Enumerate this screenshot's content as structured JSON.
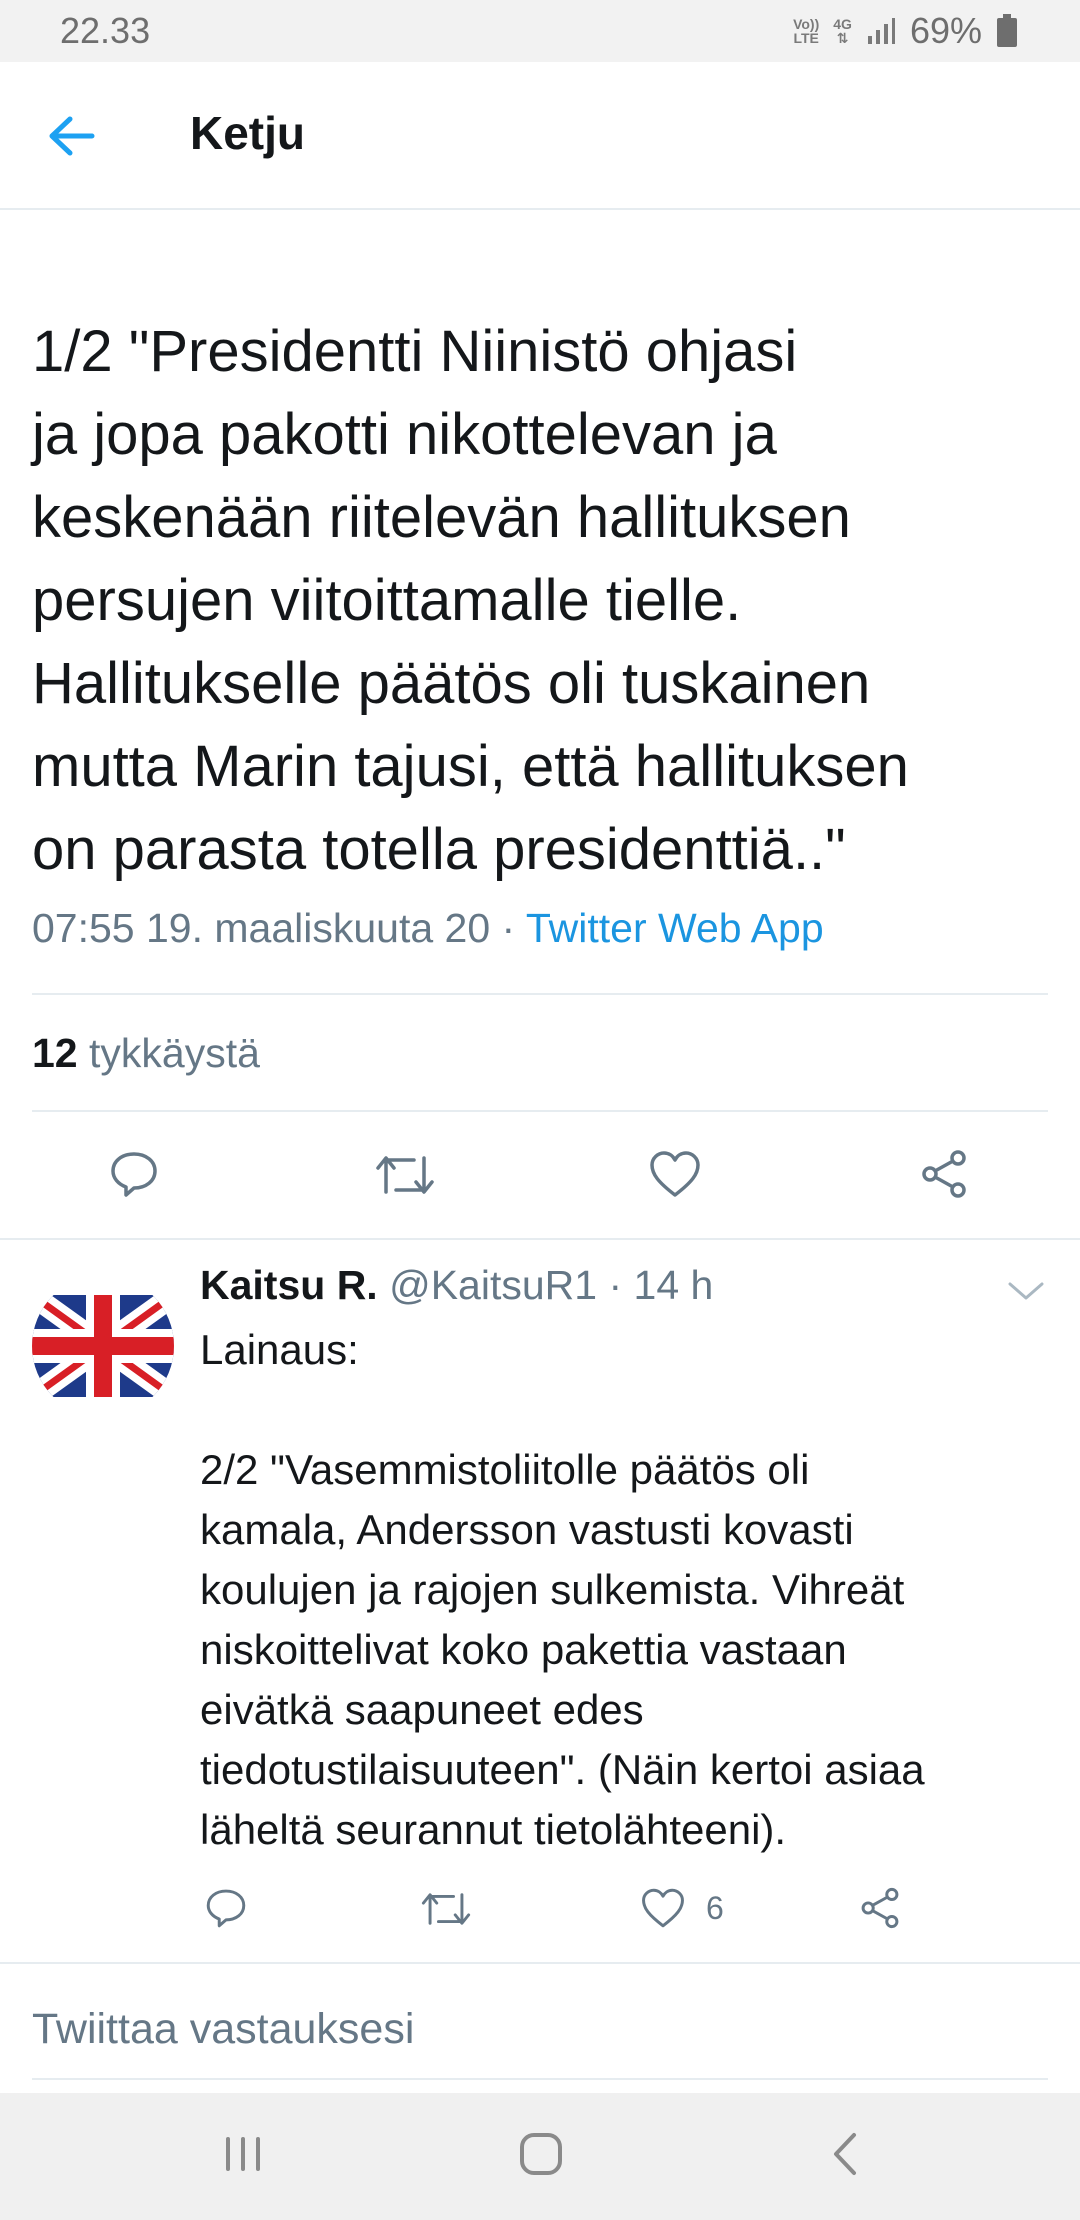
{
  "status_bar": {
    "time": "22.33",
    "volte_top": "Vo))",
    "volte_bottom": "LTE",
    "network": "4G",
    "battery": "69%"
  },
  "header": {
    "title": "Ketju",
    "back_icon": "arrow-left-icon"
  },
  "tweet": {
    "text": "1/2 \"Presidentti Niinistö ohjasi\nja jopa pakotti nikottelevan ja\nkeskenään riitelevän hallituksen\npersujen viitoittamalle tielle.\nHallitukselle päätös oli tuskainen\nmutta Marin tajusi, että hallituksen\non parasta totella presidenttiä..\"",
    "timestamp": "07:55 19. maaliskuuta 20",
    "separator": " · ",
    "source_app": "Twitter Web App",
    "likes_count": "12",
    "likes_label": " tykkäystä"
  },
  "reply": {
    "name": "Kaitsu R.",
    "handle": " @KaitsuR1",
    "time": " · 14 h",
    "text": "Lainaus:\n\n2/2 \"Vasemmistoliitolle päätös oli\nkamala, Andersson vastusti kovasti\nkoulujen ja rajojen sulkemista. Vihreät\nniskoittelivat koko pakettia vastaan\neivätkä saapuneet edes\ntiedotustilaisuuteen\". (Näin kertoi asiaa\nläheltä seurannut tietolähteeni).",
    "like_count": "6"
  },
  "compose": {
    "placeholder": "Twiittaa vastauksesi"
  },
  "colors": {
    "accent": "#1b95e0",
    "secondary_text": "#657786",
    "divider": "#e6ecf0"
  },
  "icons": [
    "reply-icon",
    "retweet-icon",
    "like-icon",
    "share-icon",
    "chevron-down-icon",
    "recents-icon",
    "home-icon",
    "back-icon"
  ]
}
